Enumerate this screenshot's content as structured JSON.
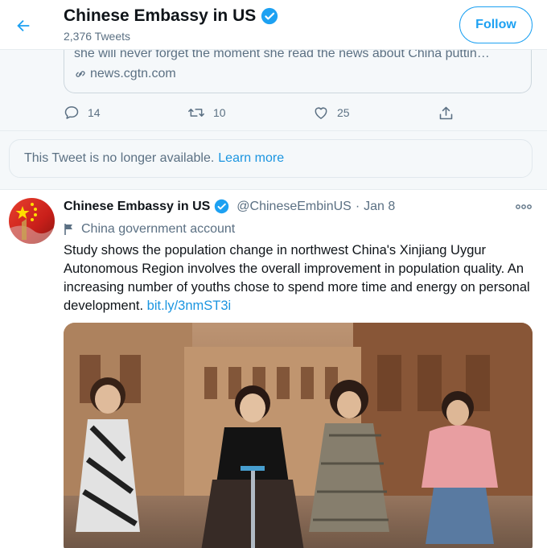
{
  "header": {
    "title": "Chinese Embassy in US",
    "tweet_count": "2,376 Tweets",
    "follow_label": "Follow"
  },
  "quoted_card": {
    "description": "she will never forget the moment she read the news about China puttin…",
    "domain": "news.cgtn.com"
  },
  "actions": {
    "replies": "14",
    "retweets": "10",
    "likes": "25"
  },
  "unavailable": {
    "text": "This Tweet is no longer available.",
    "learn_more": "Learn more"
  },
  "tweet": {
    "name": "Chinese Embassy in US",
    "handle": "@ChineseEmbinUS",
    "dot": "·",
    "date": "Jan 8",
    "label": "China government account",
    "text": "Study shows the population change in northwest China's Xinjiang Uygur Autonomous Region involves the overall improvement in population quality. An increasing number of youths chose to spend more time and energy on personal development. ",
    "link": "bit.ly/3nmST3i"
  },
  "colors": {
    "accent": "#1da1f2",
    "link": "#1b95e0",
    "muted": "#5b7083",
    "gray_bg": "#f5f8fa"
  },
  "icons": [
    "back-arrow-icon",
    "verified-badge-icon",
    "link-icon",
    "reply-icon",
    "retweet-icon",
    "like-icon",
    "share-icon",
    "flag-icon",
    "more-icon"
  ]
}
